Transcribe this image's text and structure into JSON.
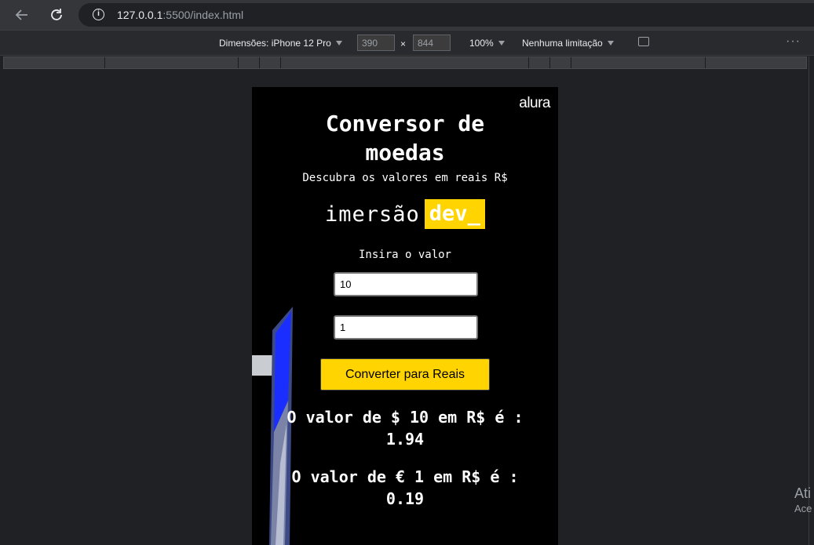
{
  "browser": {
    "url_host": "127.0.0.1",
    "url_rest": ":5500/index.html"
  },
  "devtools": {
    "dimensions_label": "Dimensões: iPhone 12 Pro",
    "width": "390",
    "times": "×",
    "height": "844",
    "zoom": "100%",
    "throttling": "Nenhuma limitação",
    "more": "⋮"
  },
  "watermark": {
    "line1": "Ati",
    "line2": "Ace"
  },
  "page": {
    "logo": "alura",
    "title": "Conversor de moedas",
    "subtitle": "Descubra os valores em reais R$",
    "brand_word": "imersão",
    "brand_tag": "dev_",
    "input_label": "Insira o valor",
    "input_1_value": "10",
    "input_2_value": "1",
    "convert_button": "Converter para Reais",
    "result_1": "O valor de $ 10 em R$ é : 1.94",
    "result_2": "O valor de € 1 em R$ é : 0.19"
  },
  "colors": {
    "accent": "#ffd400",
    "page_background": "#000000"
  }
}
